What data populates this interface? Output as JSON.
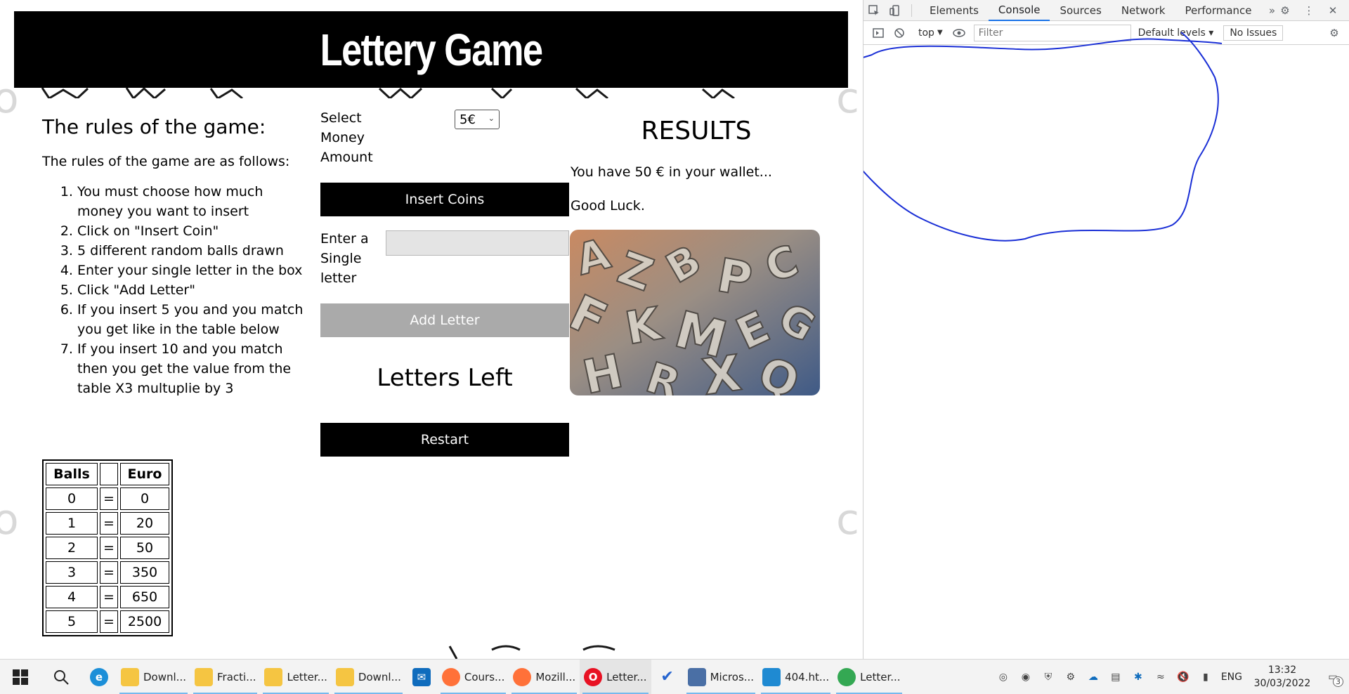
{
  "page": {
    "title": "Lettery Game",
    "rules": {
      "heading": "The rules of the game:",
      "intro": "The rules of the game are as follows:",
      "items": [
        "You must choose how much money you want to insert",
        "Click on \"Insert Coin\"",
        "5 different random balls drawn",
        "Enter your single letter in the box",
        "Click \"Add Letter\"",
        "If you insert 5 you and you match you get like in the table below",
        "If you insert 10 and you match then you get the value from the table X3 multuplie by 3"
      ]
    },
    "table": {
      "headers": [
        "Balls",
        "",
        "Euro"
      ],
      "rows": [
        [
          "0",
          "=",
          "0"
        ],
        [
          "1",
          "=",
          "20"
        ],
        [
          "2",
          "=",
          "50"
        ],
        [
          "3",
          "=",
          "350"
        ],
        [
          "4",
          "=",
          "650"
        ],
        [
          "5",
          "=",
          "2500"
        ]
      ]
    },
    "controls": {
      "money_label": "Select Money Amount",
      "money_value": "5€",
      "insert_coins": "Insert Coins",
      "letter_label": "Enter a Single letter",
      "letter_value": "",
      "add_letter": "Add Letter",
      "letters_left": "Letters Left",
      "restart": "Restart"
    },
    "results": {
      "heading": "RESULTS",
      "wallet": "You have 50 € in your wallet...",
      "luck": "Good Luck."
    }
  },
  "devtools": {
    "tabs": [
      "Elements",
      "Console",
      "Sources",
      "Network",
      "Performance"
    ],
    "active_tab": "Console",
    "more": "»",
    "context": "top",
    "filter_placeholder": "Filter",
    "levels": "Default levels ▾",
    "issues": "No Issues",
    "accent": "#1a73e8",
    "scribble_color": "#1a2fd6"
  },
  "taskbar": {
    "apps": [
      {
        "label": "Downl...",
        "icon": "folder-icon",
        "color": "#f5c542"
      },
      {
        "label": "Fracti...",
        "icon": "folder-icon",
        "color": "#f5c542"
      },
      {
        "label": "Letter...",
        "icon": "folder-icon",
        "color": "#f5c542"
      },
      {
        "label": "Downl...",
        "icon": "folder-icon",
        "color": "#f5c542"
      },
      {
        "label": "Cours...",
        "icon": "firefox-icon",
        "color": "#ff7139"
      },
      {
        "label": "Mozill...",
        "icon": "firefox-icon",
        "color": "#ff7139"
      },
      {
        "label": "Letter...",
        "icon": "opera-icon",
        "color": "#e81123"
      },
      {
        "label": "Micros...",
        "icon": "app-grid-icon",
        "color": "#4a6fa5"
      },
      {
        "label": "404.ht...",
        "icon": "vscode-icon",
        "color": "#1f8ad2"
      },
      {
        "label": "Letter...",
        "icon": "chrome-icon",
        "color": "#34a853"
      }
    ],
    "language": "ENG",
    "time": "13:32",
    "date": "30/03/2022",
    "notifications": "3"
  }
}
